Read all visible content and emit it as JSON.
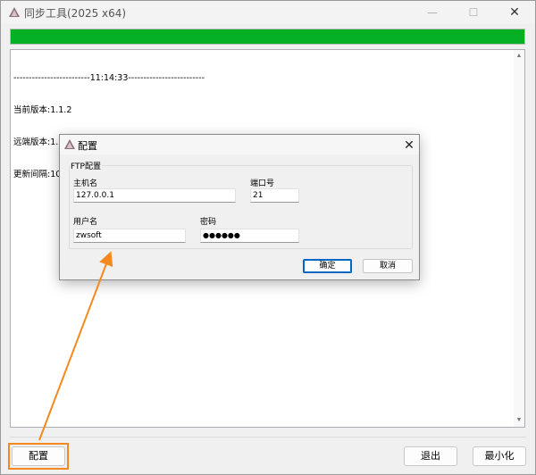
{
  "window": {
    "title": "同步工具(2025 x64)",
    "icon": "app-logo-icon",
    "controls": {
      "minimize": "—",
      "maximize": "☐",
      "close": "✕"
    }
  },
  "progress": {
    "value_percent": 100,
    "color": "#06b025"
  },
  "log": {
    "lines": [
      "-------------------------11:14:33-------------------------",
      "当前版本:1.1.2",
      "远端版本:1.1.2",
      "更新间隔:10"
    ]
  },
  "footer": {
    "config_label": "配置",
    "exit_label": "退出",
    "minimize_label": "最小化",
    "highlight_color": "#f5891f"
  },
  "dialog": {
    "title": "配置",
    "close": "✕",
    "group_title": "FTP配置",
    "host_label": "主机名",
    "host_value": "127.0.0.1",
    "port_label": "端口号",
    "port_value": "21",
    "user_label": "用户名",
    "user_value": "zwsoft",
    "password_label": "密码",
    "password_value": "●●●●●●",
    "ok_label": "确定",
    "cancel_label": "取消",
    "accent_color": "#0067c0"
  },
  "annotation": {
    "arrow_color": "#f5891f"
  }
}
